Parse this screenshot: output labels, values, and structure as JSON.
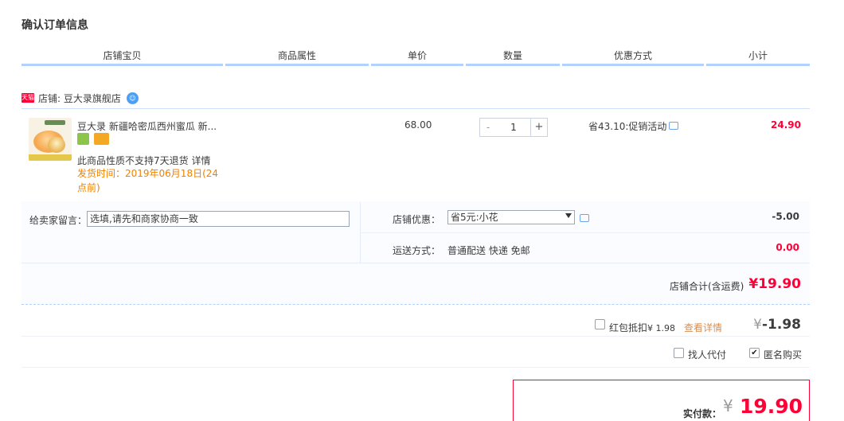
{
  "page": {
    "title": "确认订单信息"
  },
  "columns": [
    "店铺宝贝",
    "商品属性",
    "单价",
    "数量",
    "优惠方式",
    "小计"
  ],
  "shop": {
    "badge": "天猫",
    "label": "店铺: 豆大录旗舰店",
    "ww_icon": "ww-chat-icon"
  },
  "item": {
    "title": "豆大录 新疆哈密瓜西州蜜瓜 新...",
    "note": "此商品性质不支持7天退货 详情",
    "ship_time": "发货时间：2019年06月18日(24点前)",
    "unit_price": "68.00",
    "quantity": "1",
    "minus": "-",
    "plus": "+",
    "promo": "省43.10:促销活动",
    "subtotal": "24.90"
  },
  "message": {
    "label": "给卖家留言：",
    "placeholder": "选填,请先和商家协商一致"
  },
  "shop_discount": {
    "label": "店铺优惠：",
    "selected": "省5元:小花",
    "amount": "-5.00"
  },
  "shipping": {
    "label": "运送方式：",
    "value": "普通配送 快递 免邮",
    "fee": "0.00"
  },
  "shop_total": {
    "label": "店铺合计(含运费)",
    "value": "¥19.90"
  },
  "redpack": {
    "label": "红包抵扣",
    "amount": "¥ 1.98",
    "link": "查看详情",
    "yen": "¥",
    "deduct": "-1.98"
  },
  "options": {
    "friend_pay": "找人代付",
    "anonymous": "匿名购买",
    "anonymous_checked": "✔"
  },
  "payment": {
    "label": "实付款：",
    "yen": "¥",
    "value": "19.90"
  },
  "colors": {
    "accent": "#ff0036",
    "header_line": "#b2d1ff",
    "ship_time": "#f08200"
  }
}
